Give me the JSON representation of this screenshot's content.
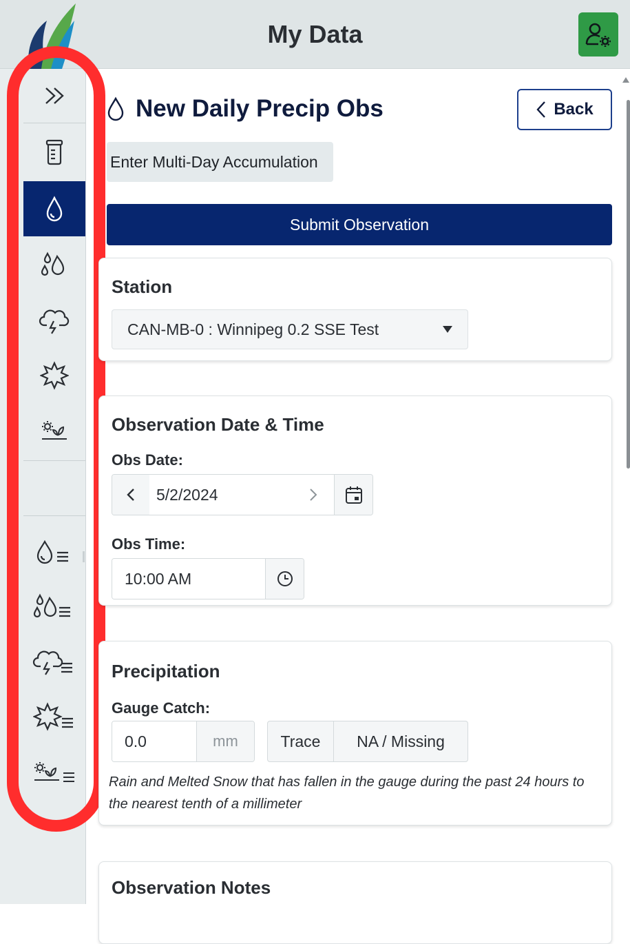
{
  "header": {
    "title": "My Data"
  },
  "sidebar": {
    "items": [
      {
        "name": "expand",
        "icon": "chevrons-right-icon"
      },
      {
        "name": "gauge",
        "icon": "rain-gauge-icon"
      },
      {
        "name": "daily-precip",
        "icon": "droplet-icon",
        "active": true
      },
      {
        "name": "multi-day",
        "icon": "droplets-icon"
      },
      {
        "name": "significant-weather",
        "icon": "storm-cloud-icon"
      },
      {
        "name": "hail",
        "icon": "hail-burst-icon"
      },
      {
        "name": "condition-monitoring",
        "icon": "gear-plant-icon"
      },
      {
        "name": "daily-precip-list",
        "icon": "droplet-list-icon"
      },
      {
        "name": "multi-day-list",
        "icon": "droplets-list-icon"
      },
      {
        "name": "significant-weather-list",
        "icon": "storm-cloud-list-icon"
      },
      {
        "name": "hail-list",
        "icon": "hail-burst-list-icon"
      },
      {
        "name": "condition-monitoring-list",
        "icon": "gear-plant-list-icon"
      }
    ]
  },
  "page": {
    "title": "New Daily Precip Obs",
    "back_label": "Back",
    "multi_day_label": "Enter Multi-Day Accumulation",
    "submit_label": "Submit Observation"
  },
  "station": {
    "heading": "Station",
    "selected": "CAN-MB-0 : Winnipeg 0.2 SSE Test"
  },
  "obs_datetime": {
    "heading": "Observation Date & Time",
    "date_label": "Obs Date:",
    "date_value": "5/2/2024",
    "time_label": "Obs Time:",
    "time_value": "10:00 AM"
  },
  "precipitation": {
    "heading": "Precipitation",
    "gauge_label": "Gauge Catch:",
    "gauge_value": "0.0",
    "unit": "mm",
    "trace_label": "Trace",
    "na_label": "NA / Missing",
    "help": "Rain and Melted Snow that has fallen in the gauge during the past 24 hours to the nearest tenth of a millimeter"
  },
  "notes": {
    "heading": "Observation Notes"
  },
  "colors": {
    "brand_navy": "#07266f",
    "accent_green": "#2f9a46",
    "highlight_red": "#ff2d2d",
    "header_bg": "#dfe5e6"
  }
}
